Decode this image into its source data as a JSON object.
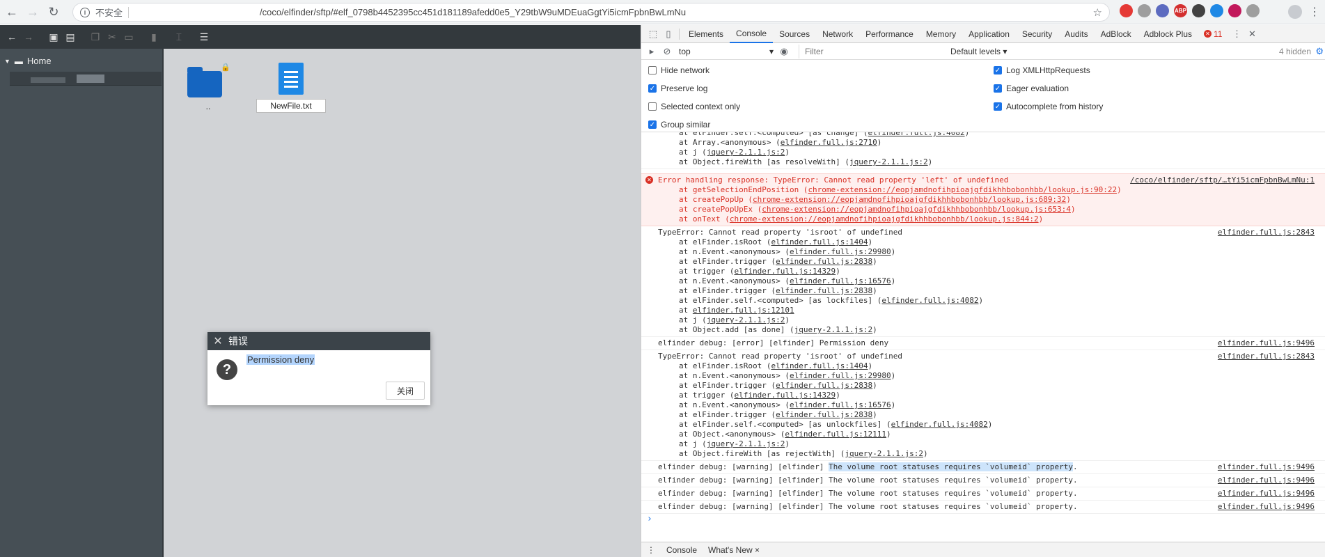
{
  "browser": {
    "security_label": "不安全",
    "url": "/coco/elfinder/sftp/#elf_0798b4452395cc451d181189afedd0e5_Y29tbW9uMDEuaGgtYi5icmFpbnBwLmNu",
    "back_icon": "arrow-left-icon",
    "forward_icon": "arrow-right-icon",
    "reload_icon": "reload-icon",
    "extensions": [
      {
        "label": "",
        "color": "#e53935"
      },
      {
        "label": "",
        "color": "#9e9e9e"
      },
      {
        "label": "",
        "color": "#5c6bc0"
      },
      {
        "label": "ABP",
        "color": "#d32f2f"
      },
      {
        "label": "",
        "color": "#424242"
      },
      {
        "label": "",
        "color": "#1e88e5"
      },
      {
        "label": "",
        "color": "#c2185b"
      },
      {
        "label": "",
        "color": "#9e9e9e"
      }
    ]
  },
  "elfinder": {
    "tree_root": "Home",
    "files": [
      {
        "name": "..",
        "type": "folder"
      },
      {
        "name": "NewFile.txt",
        "type": "text"
      }
    ],
    "dialog": {
      "title": "错误",
      "message": "Permission deny",
      "button": "关闭"
    }
  },
  "devtools": {
    "tabs": [
      "Elements",
      "Console",
      "Sources",
      "Network",
      "Performance",
      "Memory",
      "Application",
      "Security",
      "Audits",
      "AdBlock",
      "Adblock Plus"
    ],
    "active_tab": "Console",
    "error_count": "11",
    "context": "top",
    "filter_placeholder": "Filter",
    "levels": "Default levels ▾",
    "hidden": "4 hidden",
    "settings": {
      "hide_network": "Hide network",
      "preserve_log": "Preserve log",
      "selected_context": "Selected context only",
      "group_similar": "Group similar",
      "log_xhr": "Log XMLHttpRequests",
      "eager_eval": "Eager evaluation",
      "autocomplete": "Autocomplete from history"
    },
    "drawer_tabs": [
      "Console",
      "What's New ×"
    ]
  },
  "console": {
    "trace_tail": [
      "at elFinder.self.<computed> [as change] (elfinder.full.js:4082)",
      "at Array.<anonymous> (elfinder.full.js:2710)",
      "at j (jquery-2.1.1.js:2)",
      "at Object.fireWith [as resolveWith] (jquery-2.1.1.js:2)"
    ],
    "error": {
      "text": "Error handling response: TypeError: Cannot read property 'left' of undefined",
      "src": "/coco/elfinder/sftp/…tYi5icmFpbnBwLmNu:1",
      "frames": [
        "at getSelectionEndPosition (chrome-extension://eopjamdnofihpioajgfdikhhbobonhbb/lookup.js:90:22)",
        "at createPopUp (chrome-extension://eopjamdnofihpioajgfdikhhbobonhbb/lookup.js:689:32)",
        "at createPopUpEx (chrome-extension://eopjamdnofihpioajgfdikhhbobonhbb/lookup.js:653:4)",
        "at onText (chrome-extension://eopjamdnofihpioajgfdikhhbobonhbb/lookup.js:844:2)"
      ]
    },
    "type_error_1": {
      "text": "TypeError: Cannot read property 'isroot' of undefined",
      "src": "elfinder.full.js:2843",
      "frames": [
        "at elFinder.isRoot (elfinder.full.js:1404)",
        "at n.Event.<anonymous> (elfinder.full.js:29980)",
        "at elFinder.trigger (elfinder.full.js:2838)",
        "at trigger (elfinder.full.js:14329)",
        "at n.Event.<anonymous> (elfinder.full.js:16576)",
        "at elFinder.trigger (elfinder.full.js:2838)",
        "at elFinder.self.<computed> [as lockfiles] (elfinder.full.js:4082)",
        "at elfinder.full.js:12101",
        "at j (jquery-2.1.1.js:2)",
        "at Object.add [as done] (jquery-2.1.1.js:2)"
      ]
    },
    "debug_error": {
      "text": "elfinder debug: [error] [elfinder] Permission deny",
      "src": "elfinder.full.js:9496"
    },
    "type_error_2": {
      "text": "TypeError: Cannot read property 'isroot' of undefined",
      "src": "elfinder.full.js:2843",
      "frames": [
        "at elFinder.isRoot (elfinder.full.js:1404)",
        "at n.Event.<anonymous> (elfinder.full.js:29980)",
        "at elFinder.trigger (elfinder.full.js:2838)",
        "at trigger (elfinder.full.js:14329)",
        "at n.Event.<anonymous> (elfinder.full.js:16576)",
        "at elFinder.trigger (elfinder.full.js:2838)",
        "at elFinder.self.<computed> [as unlockfiles] (elfinder.full.js:4082)",
        "at Object.<anonymous> (elfinder.full.js:12111)",
        "at j (jquery-2.1.1.js:2)",
        "at Object.fireWith [as rejectWith] (jquery-2.1.1.js:2)"
      ]
    },
    "warn_prefix": "elfinder debug: [warning] [elfinder] ",
    "warn_body": "The volume root statuses requires `volumeid` property",
    "warn_suffix": ".",
    "warn_src": "elfinder.full.js:9496"
  }
}
